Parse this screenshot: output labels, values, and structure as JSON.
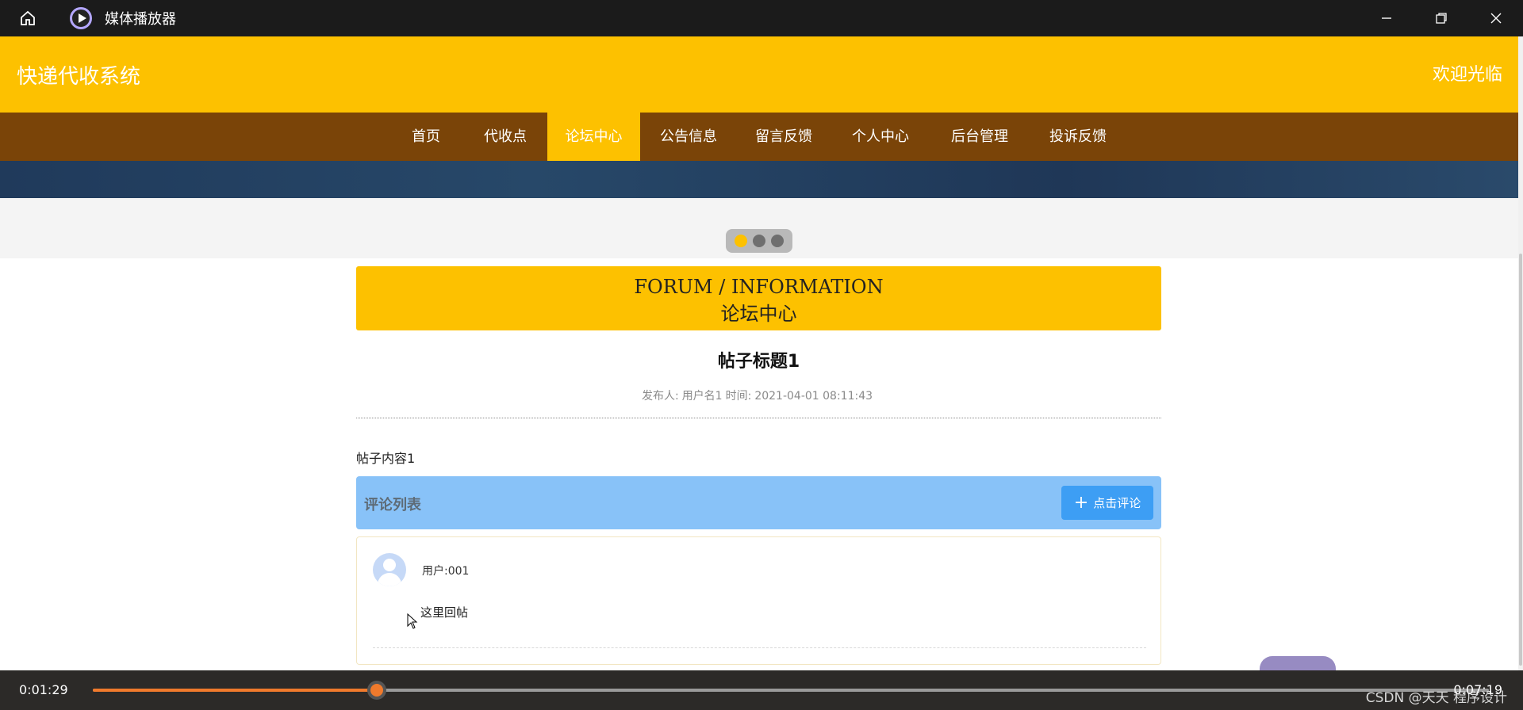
{
  "titlebar": {
    "title": "媒体播放器",
    "home_icon": "home-icon",
    "app_icon": "media-player-icon",
    "controls": [
      "minimize-icon",
      "restore-icon",
      "close-icon"
    ]
  },
  "site": {
    "title": "快递代收系统",
    "welcome": "欢迎光临",
    "colors": {
      "header": "#fdc100",
      "nav": "#7a4408",
      "active": "#fdc100"
    }
  },
  "nav": {
    "items": [
      {
        "label": "首页"
      },
      {
        "label": "代收点"
      },
      {
        "label": "论坛中心",
        "active": true
      },
      {
        "label": "公告信息"
      },
      {
        "label": "留言反馈"
      },
      {
        "label": "个人中心"
      },
      {
        "label": "后台管理"
      },
      {
        "label": "投诉反馈"
      }
    ]
  },
  "carousel": {
    "count": 3,
    "active_index": 0
  },
  "forum": {
    "title_en": "FORUM / INFORMATION",
    "title_zh": "论坛中心"
  },
  "post": {
    "title": "帖子标题1",
    "author_label": "发布人:",
    "author": "用户名1",
    "time_label": "时间:",
    "time": "2021-04-01 08:11:43",
    "content": "帖子内容1"
  },
  "comments": {
    "header": "评论列表",
    "add_button": "点击评论",
    "items": [
      {
        "user": "用户:001",
        "text": "这里回帖"
      }
    ]
  },
  "player": {
    "current_time": "0:01:29",
    "total_time": "0:07:19",
    "progress": 0.2034,
    "watermark": "CSDN @天天 程序设计"
  }
}
